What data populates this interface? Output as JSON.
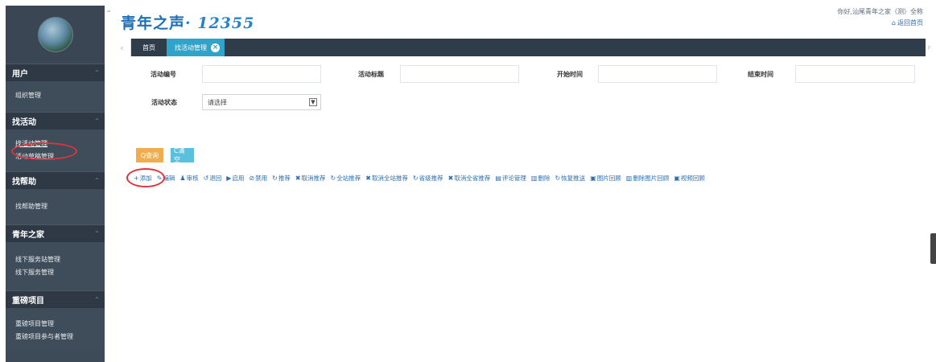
{
  "header": {
    "brand_text": "青年之声",
    "brand_number": "· 12355",
    "user_greeting": "你好,汕尾青年之家（测）全称",
    "home_link": "返回首页"
  },
  "sidebar": {
    "sections": [
      {
        "title": "用户",
        "items": [
          "组织管理"
        ]
      },
      {
        "title": "找活动",
        "items": [
          "找活动管理",
          "活动草稿管理"
        ]
      },
      {
        "title": "找帮助",
        "items": [
          "找帮助管理"
        ]
      },
      {
        "title": "青年之家",
        "items": [
          "线下服务站管理",
          "线下服务管理"
        ]
      },
      {
        "title": "重磅项目",
        "items": [
          "重磅项目管理",
          "重磅项目参与者管理"
        ]
      }
    ]
  },
  "tabs": {
    "home": "首页",
    "active": "找活动管理",
    "close_icon": "×"
  },
  "filters": {
    "activity_id_label": "活动编号",
    "activity_title_label": "活动标题",
    "start_time_label": "开始时间",
    "end_time_label": "结束时间",
    "status_label": "活动状态",
    "status_value": "请选择"
  },
  "buttons": {
    "query": "Q查询",
    "clear": "C清空"
  },
  "toolbar": [
    {
      "icon": "+",
      "label": "添加"
    },
    {
      "icon": "✎",
      "label": "编辑"
    },
    {
      "icon": "♟",
      "label": "审核"
    },
    {
      "icon": "↺",
      "label": "退回"
    },
    {
      "icon": "▶",
      "label": "启用"
    },
    {
      "icon": "⊘",
      "label": "禁用"
    },
    {
      "icon": "↻",
      "label": "推荐"
    },
    {
      "icon": "✖",
      "label": "取消推荐"
    },
    {
      "icon": "↻",
      "label": "全站推荐"
    },
    {
      "icon": "✖",
      "label": "取消全站推荐"
    },
    {
      "icon": "↻",
      "label": "省级推荐"
    },
    {
      "icon": "✖",
      "label": "取消全省推荐"
    },
    {
      "icon": "▤",
      "label": "评论管理"
    },
    {
      "icon": "▥",
      "label": "删除"
    },
    {
      "icon": "↻",
      "label": "恢复推送"
    },
    {
      "icon": "▣",
      "label": "图片回顾"
    },
    {
      "icon": "▥",
      "label": "删除图片回顾"
    },
    {
      "icon": "▣",
      "label": "视频回顾"
    }
  ],
  "colors": {
    "sidebar_bg": "#3d4a57",
    "tab_active": "#2fa3c9",
    "query_button": "#f0ad4e",
    "clear_button": "#5bc0de",
    "highlight": "#d9363e"
  }
}
